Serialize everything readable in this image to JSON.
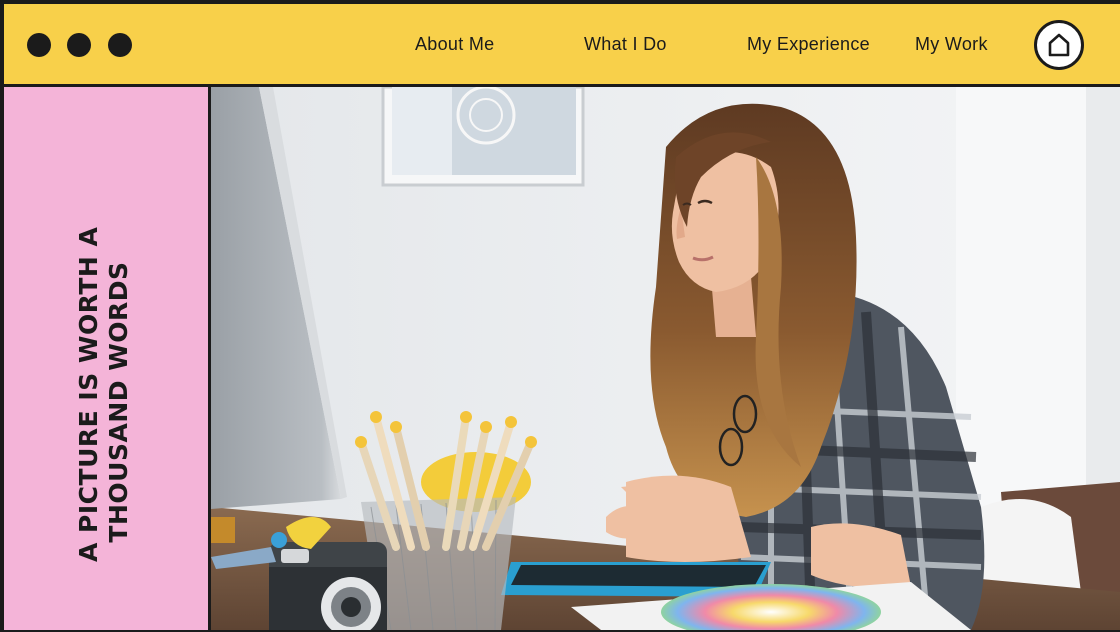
{
  "window": {
    "controls": [
      "close",
      "minimize",
      "maximize"
    ]
  },
  "nav": {
    "items": [
      {
        "label": "About Me"
      },
      {
        "label": "What I Do"
      },
      {
        "label": "My Experience"
      },
      {
        "label": "My Work"
      }
    ],
    "home_icon": "home-icon"
  },
  "sidebar": {
    "tagline_line1": "A PICTURE IS WORTH A",
    "tagline_line2": "THOUSAND WORDS"
  },
  "colors": {
    "header_bg": "#f8d04a",
    "sidebar_bg": "#f4b4d8",
    "border": "#1b1b1b"
  }
}
